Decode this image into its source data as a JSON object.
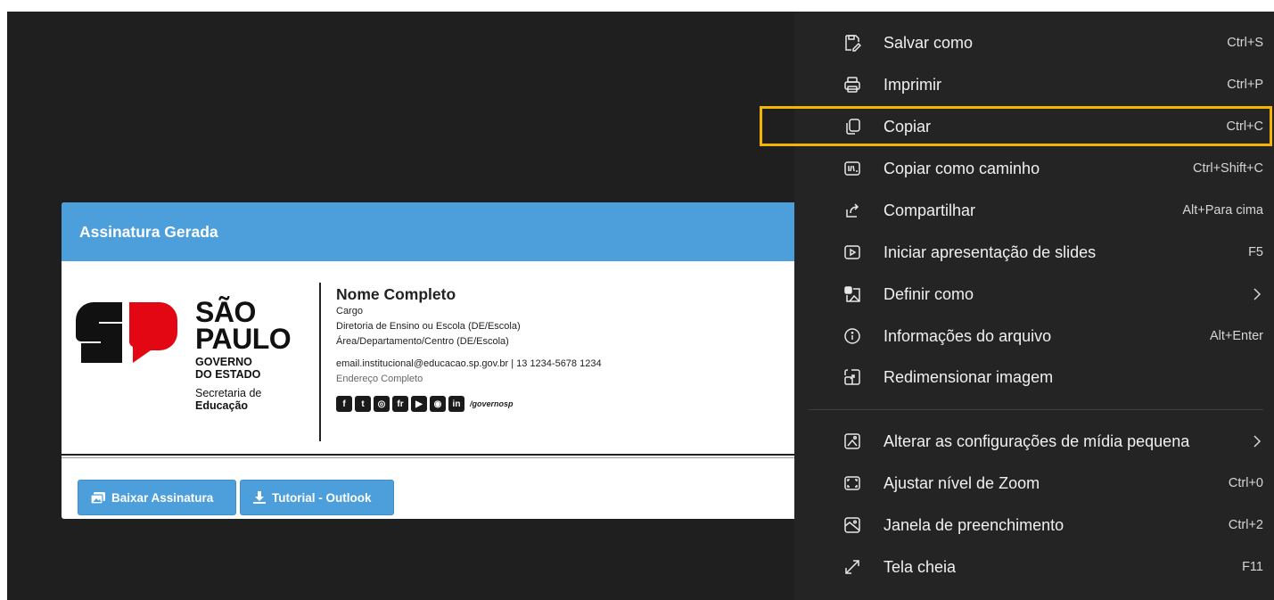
{
  "card": {
    "title": "Assinatura Gerada",
    "logo": {
      "line1": "SÃO",
      "line2": "PAULO",
      "gov1": "GOVERNO",
      "gov2": "DO ESTADO",
      "sec": "Secretaria de",
      "edu": "Educação",
      "brand_red": "#e30613",
      "brand_black": "#111111"
    },
    "signature": {
      "name": "Nome Completo",
      "role": "Cargo",
      "directorate": "Diretoria de Ensino ou Escola (DE/Escola)",
      "department": "Área/Departamento/Centro (DE/Escola)",
      "contact": "email.institucional@educacao.sp.gov.br | 13 1234-5678 1234",
      "address": "Endereço Completo",
      "social_icons": [
        "facebook-icon",
        "twitter-icon",
        "instagram-icon",
        "flickr-icon",
        "youtube-icon",
        "spotify-icon",
        "linkedin-icon"
      ],
      "social_letters": [
        "f",
        "t",
        "◎",
        "fr",
        "▶",
        "◉",
        "in"
      ],
      "handle": "/governosp"
    },
    "buttons": {
      "download": "Baixar Assinatura",
      "tutorial": "Tutorial - Outlook"
    },
    "accent_color": "#4d9fdc"
  },
  "menu": {
    "items": [
      {
        "icon": "save-as-icon",
        "label": "Salvar como",
        "shortcut": "Ctrl+S"
      },
      {
        "icon": "print-icon",
        "label": "Imprimir",
        "shortcut": "Ctrl+P"
      },
      {
        "icon": "copy-icon",
        "label": "Copiar",
        "shortcut": "Ctrl+C"
      },
      {
        "icon": "copy-path-icon",
        "label": "Copiar como caminho",
        "shortcut": "Ctrl+Shift+C"
      },
      {
        "icon": "share-icon",
        "label": "Compartilhar",
        "shortcut": "Alt+Para cima"
      },
      {
        "icon": "slideshow-icon",
        "label": "Iniciar apresentação de slides",
        "shortcut": "F5"
      },
      {
        "icon": "set-as-icon",
        "label": "Definir como",
        "shortcut": ""
      },
      {
        "icon": "info-icon",
        "label": "Informações do arquivo",
        "shortcut": "Alt+Enter"
      },
      {
        "icon": "resize-icon",
        "label": "Redimensionar imagem",
        "shortcut": ""
      },
      {
        "icon": "small-media-icon",
        "label": "Alterar as configurações de mídia pequena",
        "shortcut": ""
      },
      {
        "icon": "zoom-fit-icon",
        "label": "Ajustar nível de Zoom",
        "shortcut": "Ctrl+0"
      },
      {
        "icon": "fill-window-icon",
        "label": "Janela de preenchimento",
        "shortcut": "Ctrl+2"
      },
      {
        "icon": "fullscreen-icon",
        "label": "Tela cheia",
        "shortcut": "F11"
      }
    ],
    "highlighted_item": "Copiar",
    "highlight_color": "#f5b400"
  }
}
